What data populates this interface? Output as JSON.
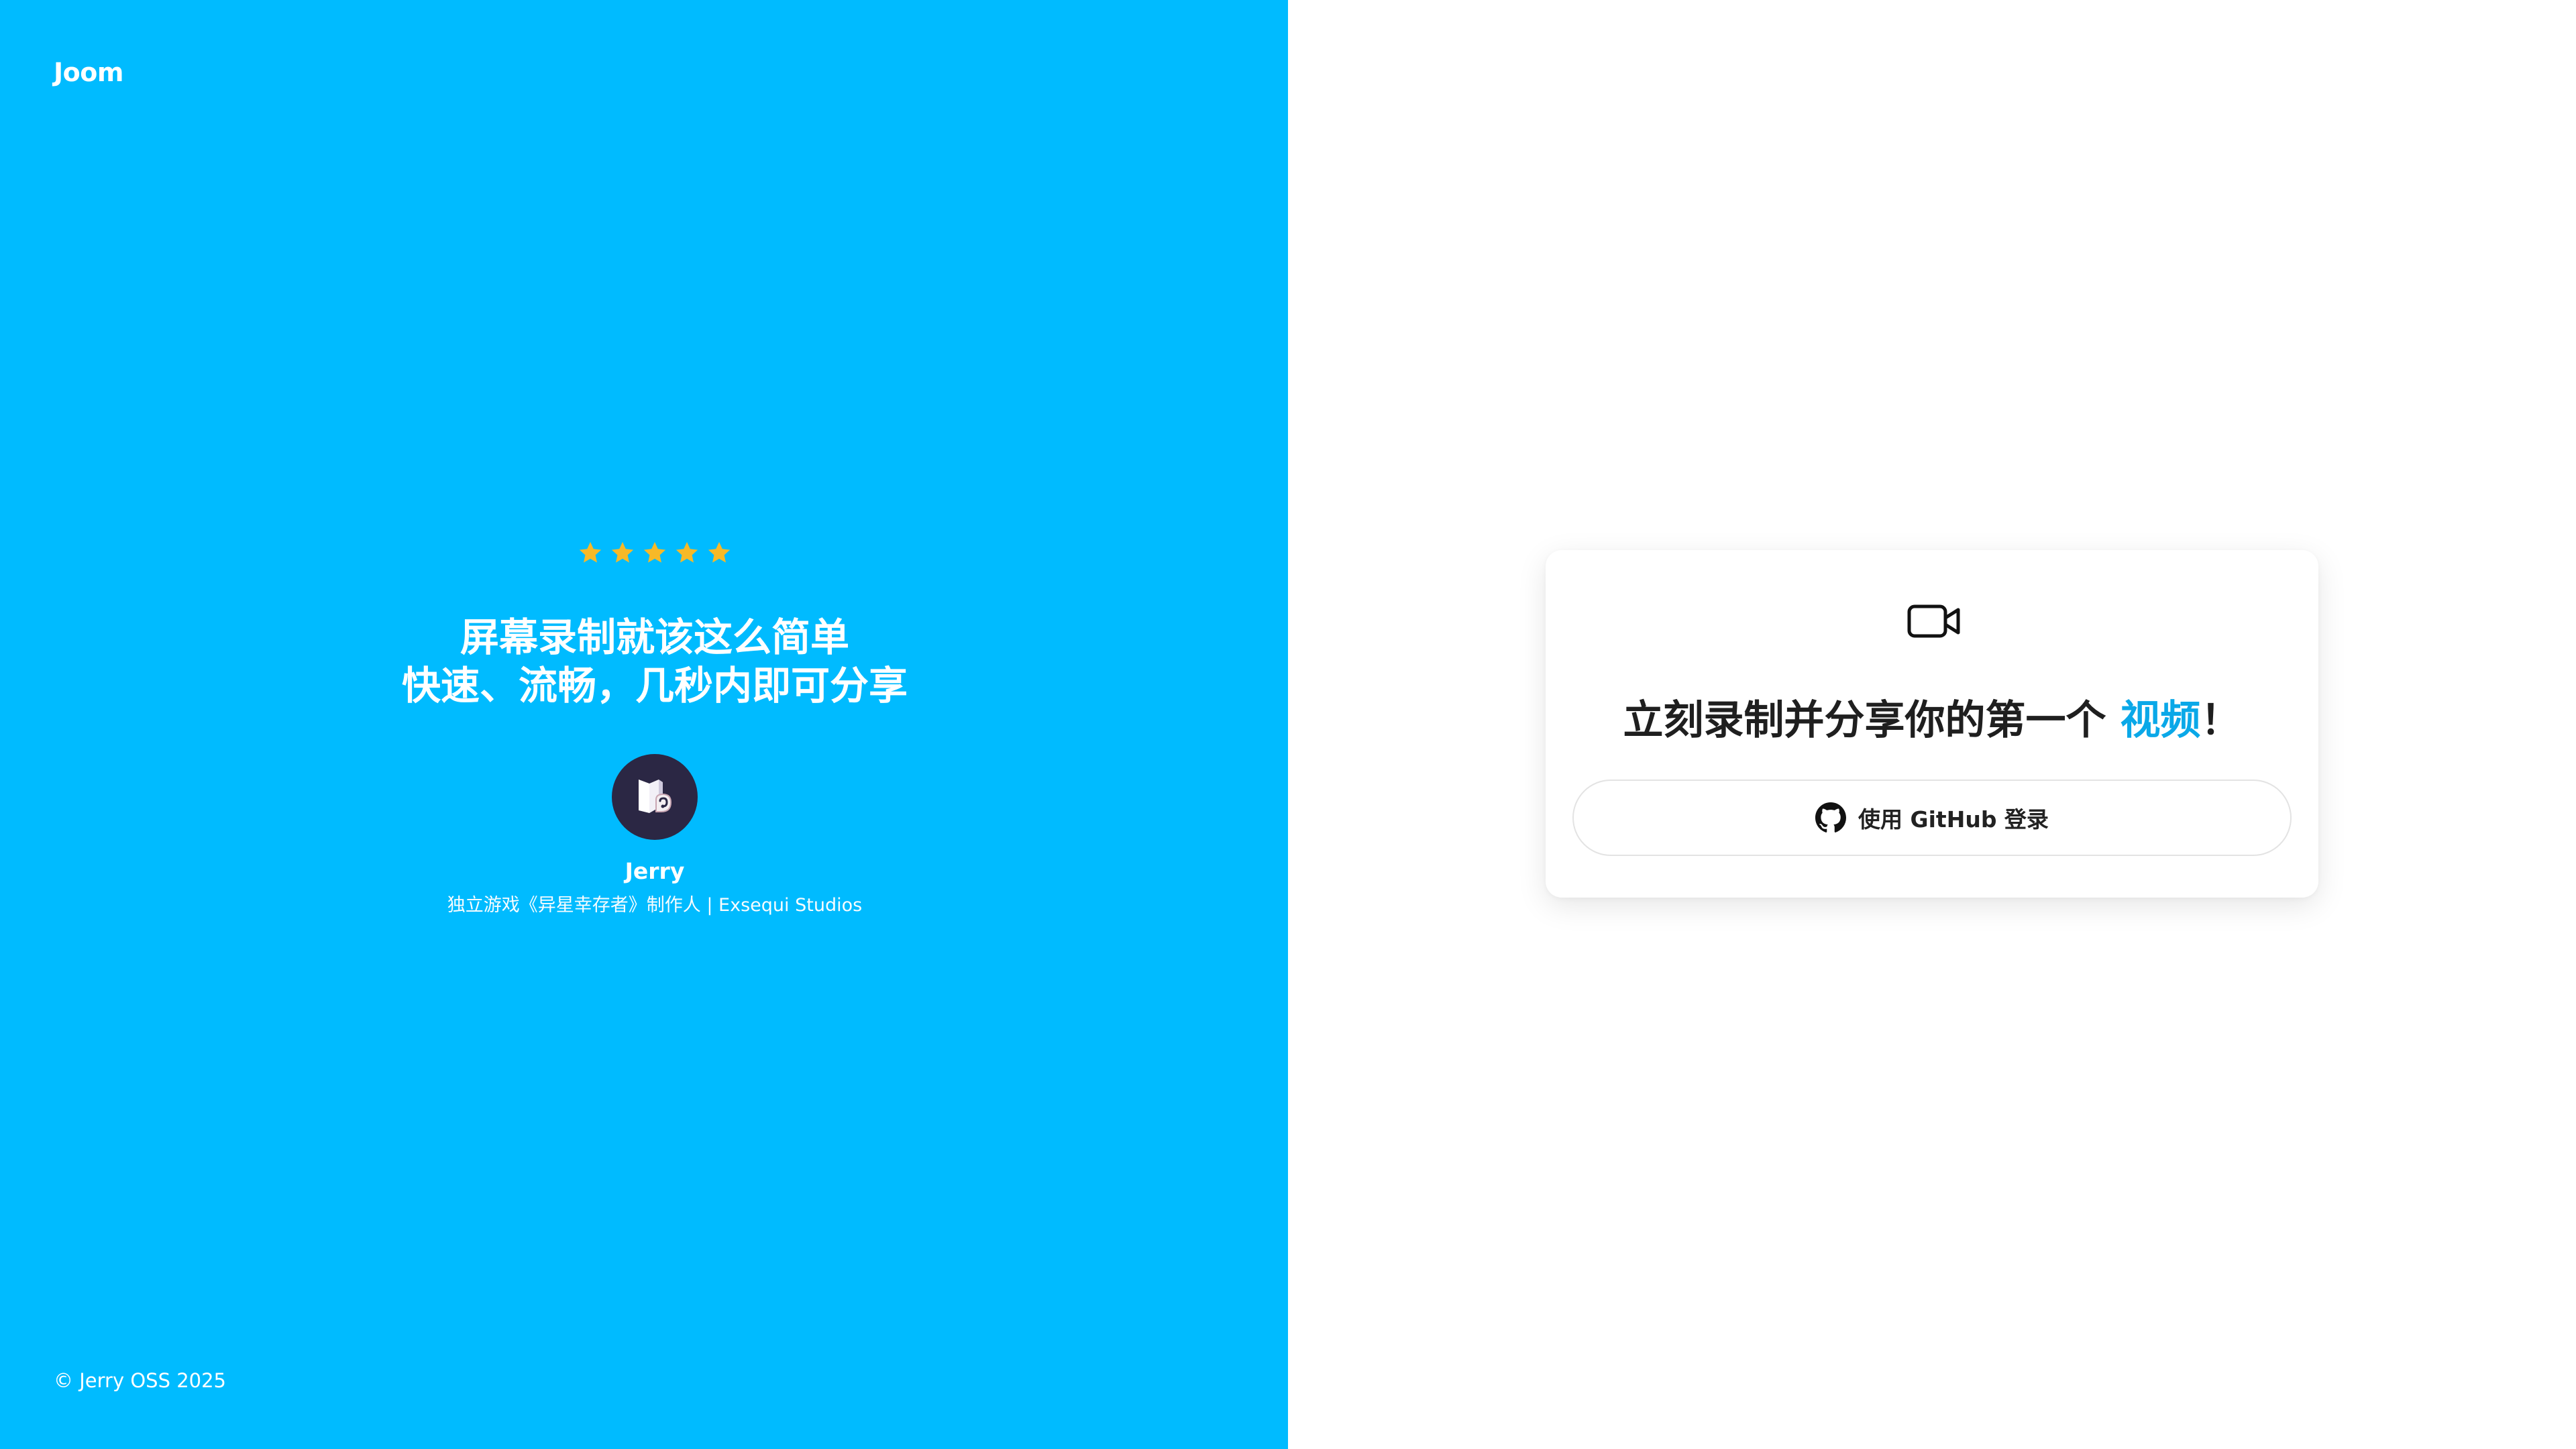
{
  "brand": {
    "logo_text": "Joom"
  },
  "testimonial": {
    "rating": 5,
    "star_color": "#f7b928",
    "headline_line1": "屏幕录制就该这么简单",
    "headline_line2": "快速、流畅，几秒内即可分享",
    "author_name": "Jerry",
    "author_role": "独立游戏《异星幸存者》制作人 | Exsequi Studios"
  },
  "footer": {
    "copyright": "© Jerry OSS 2025"
  },
  "login_card": {
    "icon": "video-camera-icon",
    "title_prefix": "立刻录制并分享你的第一个 ",
    "title_highlight": "视频",
    "title_suffix": "！",
    "github_button_label": "使用 GitHub 登录",
    "github_icon": "github-icon"
  },
  "colors": {
    "left_panel_bg": "#00bbff",
    "highlight": "#0aa8e8",
    "avatar_bg": "#2b2744"
  }
}
